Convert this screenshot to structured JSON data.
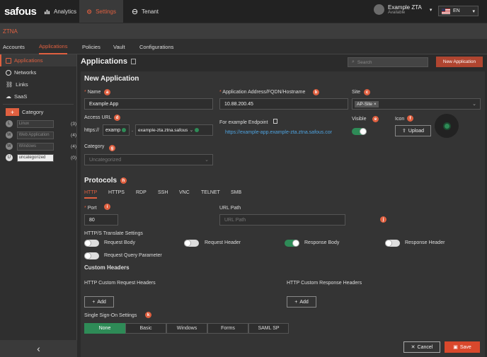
{
  "topbar": {
    "logo": "safous",
    "nav": [
      {
        "label": "Analytics",
        "icon": "bar-chart-icon"
      },
      {
        "label": "Settings",
        "icon": "gear-icon"
      },
      {
        "label": "Tenant",
        "icon": "tenant-icon"
      }
    ],
    "user_name": "Example ZTA",
    "user_status": "Available",
    "language": "EN"
  },
  "section_title": "ZTNA",
  "tabs": [
    "Accounts",
    "Applications",
    "Policies",
    "Vault",
    "Configurations"
  ],
  "sidebar": {
    "items": [
      {
        "label": "Applications",
        "icon": "applications-icon"
      },
      {
        "label": "Networks",
        "icon": "globe-icon"
      },
      {
        "label": "Links",
        "icon": "link-icon"
      },
      {
        "label": "SaaS",
        "icon": "cloud-icon"
      }
    ],
    "category_label": "Category",
    "categories": [
      {
        "badge": "L",
        "name": "Linux",
        "count": "(3)"
      },
      {
        "badge": "W",
        "name": "Web Application",
        "count": "(4)"
      },
      {
        "badge": "W",
        "name": "Windows",
        "count": "(4)"
      },
      {
        "badge": "U",
        "name": "uncategorized",
        "count": "(0)"
      }
    ],
    "collapse_glyph": "‹"
  },
  "page": {
    "title": "Applications",
    "search_placeholder": "Search",
    "new_button": "New Application"
  },
  "form": {
    "heading": "New Application",
    "name_label": "Name",
    "name_value": "Example App",
    "address_label": "Application Address/FQDN/Hostname",
    "address_value": "10.88.200.45",
    "site_label": "Site",
    "site_value": "AP-Site",
    "access_url_label": "Access URL",
    "access_prefix": "https://",
    "access_sub": "examp",
    "access_domain": "example-zta.ztna.safous",
    "endpoint_label": "For example Endpoint",
    "endpoint_value": "https://example-app.example-zta.ztna.safous.cor",
    "visible_label": "Visible",
    "icon_label": "Icon",
    "upload_label": "Upload",
    "category_label": "Category",
    "category_placeholder": "Uncategorized"
  },
  "protocols": {
    "heading": "Protocols",
    "tabs": [
      "HTTP",
      "HTTPS",
      "RDP",
      "SSH",
      "VNC",
      "TELNET",
      "SMB"
    ],
    "port_label": "Port",
    "port_value": "80",
    "url_path_label": "URL Path",
    "url_path_placeholder": "URL Path",
    "translate_label": "HTTP/S Translate Settings",
    "toggles": [
      {
        "label": "Request Body",
        "on": false
      },
      {
        "label": "Request Header",
        "on": false
      },
      {
        "label": "Response Body",
        "on": true
      },
      {
        "label": "Response Header",
        "on": false
      },
      {
        "label": "Request Query Parameter",
        "on": false
      }
    ],
    "custom_headers_heading": "Custom Headers",
    "req_headers_label": "HTTP Custom Request Headers",
    "resp_headers_label": "HTTP Custom Response Headers",
    "add_label": "Add",
    "sso_label": "Single Sign-On Settings",
    "sso_options": [
      "None",
      "Basic",
      "Windows",
      "Forms",
      "SAML SP"
    ]
  },
  "markers": [
    "a",
    "b",
    "c",
    "d",
    "e",
    "f",
    "g",
    "h",
    "i",
    "j",
    "k"
  ],
  "footer": {
    "cancel": "Cancel",
    "save": "Save"
  },
  "colors": {
    "accent": "#e06040",
    "green": "#2e8b57"
  }
}
